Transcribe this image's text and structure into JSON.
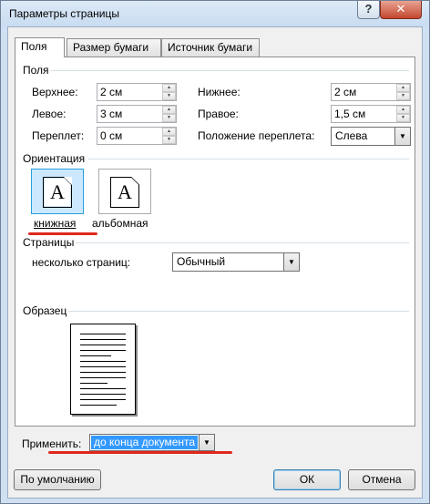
{
  "window": {
    "title": "Параметры страницы",
    "help_label": "?",
    "close_label": "✕"
  },
  "tabs": [
    {
      "label": "Поля",
      "active": true
    },
    {
      "label": "Размер бумаги",
      "active": false
    },
    {
      "label": "Источник бумаги",
      "active": false
    }
  ],
  "margins": {
    "group_label": "Поля",
    "top": {
      "label": "Верхнее:",
      "value": "2 см"
    },
    "left": {
      "label": "Левое:",
      "value": "3 см"
    },
    "gutter": {
      "label": "Переплет:",
      "value": "0 см"
    },
    "bottom": {
      "label": "Нижнее:",
      "value": "2 см"
    },
    "right": {
      "label": "Правое:",
      "value": "1,5 см"
    },
    "gutter_position": {
      "label": "Положение переплета:",
      "value": "Слева"
    }
  },
  "orientation": {
    "group_label": "Ориентация",
    "portrait": {
      "label": "книжная",
      "glyph": "A",
      "selected": true
    },
    "landscape": {
      "label": "альбомная",
      "glyph": "A",
      "selected": false
    }
  },
  "pages": {
    "group_label": "Страницы",
    "multiple_label": "несколько страниц:",
    "multiple_value": "Обычный"
  },
  "preview": {
    "group_label": "Образец"
  },
  "apply": {
    "label": "Применить:",
    "value": "до конца документа"
  },
  "buttons": {
    "default_label": "По умолчанию",
    "ok_label": "ОК",
    "cancel_label": "Отмена"
  },
  "colors": {
    "annotation_red": "#e0281d",
    "selection_blue": "#3399ff"
  },
  "icons": {
    "spin_up": "▲",
    "spin_down": "▼",
    "dropdown": "▼"
  }
}
